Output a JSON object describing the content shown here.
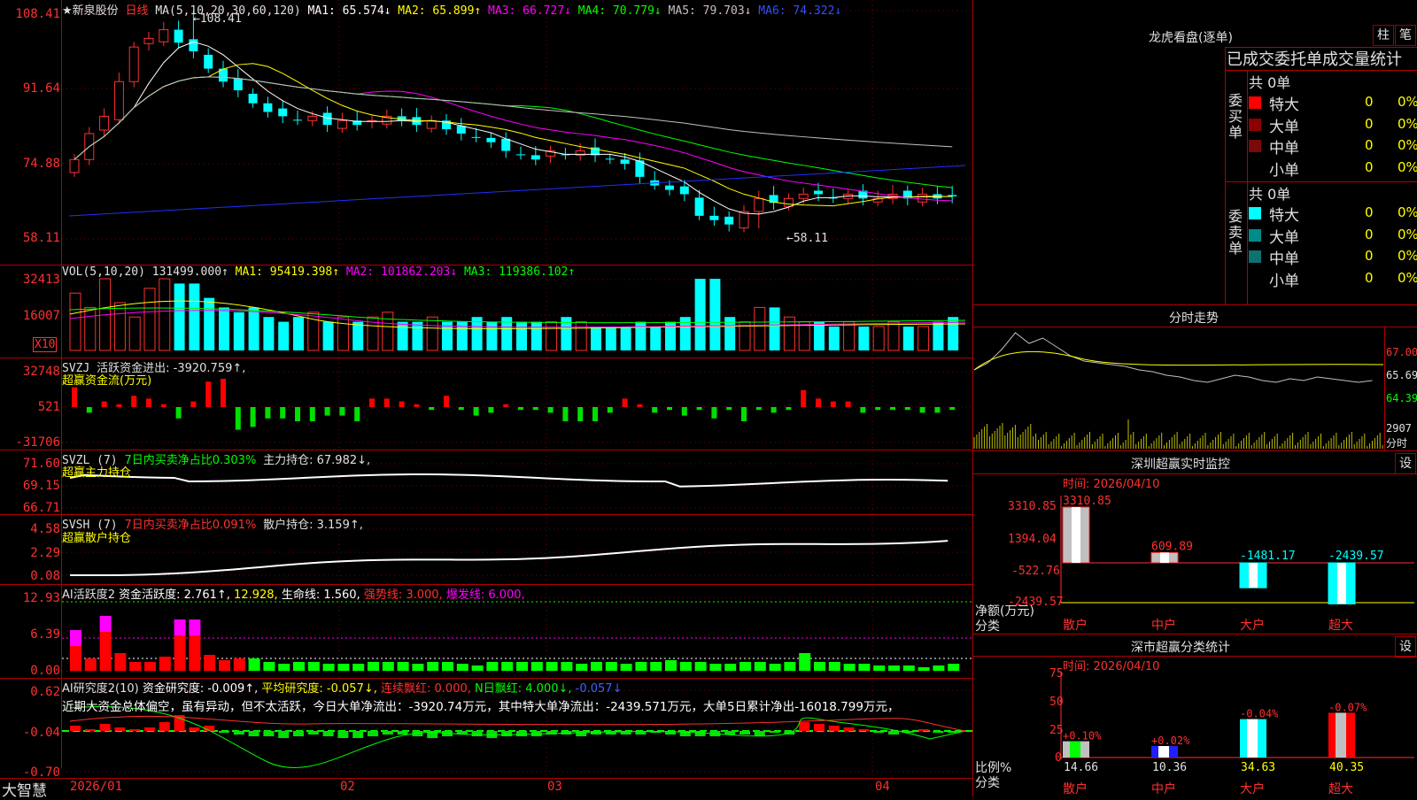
{
  "main_chart": {
    "stock_name": "新泉股份",
    "period": "日线",
    "ma_label": "MA(5,10,20,30,60,120)",
    "ma1": "MA1: 65.574↓",
    "ma2": "MA2: 65.899↑",
    "ma3": "MA3: 66.727↓",
    "ma4": "MA4: 70.779↓",
    "ma5": "MA5: 79.703↓",
    "ma6": "MA6: 74.322↓",
    "y_ticks": [
      "108.41",
      "91.64",
      "74.88",
      "58.11"
    ],
    "high_mark": "108.41",
    "low_mark": "58.11",
    "colors": {
      "up": "#ff3030",
      "down": "#00ffff",
      "ma1": "#ffffff",
      "ma2": "#ffff00",
      "ma3": "#ff00ff",
      "ma4": "#00ff00",
      "ma5": "#c0c0c0",
      "ma6": "#0000ff"
    }
  },
  "vol_panel": {
    "title": "VOL(5,10,20)",
    "value": "131499.000↑",
    "ma1": "MA1: 95419.398↑",
    "ma2": "MA2: 101862.203↓",
    "ma3": "MA3: 119386.102↑",
    "y_ticks": [
      "32413",
      "16007"
    ],
    "unit": "X10"
  },
  "svzj_panel": {
    "title": "SVZJ",
    "label": "活跃资金进出: -3920.759↑,",
    "sub": "超赢资金流(万元)",
    "y_ticks": [
      "32748",
      "521",
      "-31706"
    ]
  },
  "svzl_panel": {
    "title": "SVZL (7)",
    "net": "7日内买卖净占比0.303%",
    "hold": "主力持仓: 67.982↓,",
    "sub": "超赢主力持仓",
    "y_ticks": [
      "71.60",
      "69.15",
      "66.71"
    ]
  },
  "svsh_panel": {
    "title": "SVSH (7)",
    "net": "7日内买卖净占比0.091%",
    "hold": "散户持仓: 3.159↑,",
    "sub": "超赢散户持仓",
    "y_ticks": [
      "4.58",
      "2.29",
      "0.08"
    ]
  },
  "ai_active_panel": {
    "title": "AI活跃度2",
    "v1": "资金活跃度: 2.761↑,",
    "v2": "12.928,",
    "v3": "生命线: 1.560,",
    "v4": "强势线: 3.000,",
    "v5": "爆发线: 6.000,",
    "y_ticks": [
      "12.93",
      "6.39",
      "0.00"
    ]
  },
  "ai_research_panel": {
    "title": "AI研究度2(10)",
    "v1": "资金研究度: -0.009↑,",
    "v2": "平均研究度: -0.057↓,",
    "v3": "连续飘红: 0.000,",
    "v4": "N日飘红: 4.000↓,",
    "v5": "-0.057↓",
    "summary": "近期大资金总体偏空，虽有异动，但不太活跃，今日大单净流出：-3920.74万元，其中特大单净流出：-2439.571万元，大单5日累计净出-16018.799万元，",
    "y_ticks": [
      "0.62",
      "-0.04",
      "-0.70"
    ]
  },
  "date_axis": {
    "year_start": "2026/01",
    "months": [
      "02",
      "03",
      "04"
    ]
  },
  "brand": "大智慧",
  "right": {
    "dragon_title": "龙虎看盘(逐单)",
    "btn_zhu": "柱",
    "btn_bi": "笔",
    "tabs": [
      "已成交委托单成交量统计"
    ],
    "buy_label": "委买单",
    "sell_label": "委卖单",
    "buy_total": "共 0单",
    "sell_total": "共 0单",
    "buy_rows": [
      {
        "name": "特大",
        "count": "0",
        "pct": "0%",
        "color": "#ff0000"
      },
      {
        "name": "大单",
        "count": "0",
        "pct": "0%",
        "color": "#8b0000"
      },
      {
        "name": "中单",
        "count": "0",
        "pct": "0%",
        "color": "#7a0a0a"
      },
      {
        "name": "小单",
        "count": "0",
        "pct": "0%",
        "color": ""
      }
    ],
    "sell_rows": [
      {
        "name": "特大",
        "count": "0",
        "pct": "0%",
        "color": "#00ffff"
      },
      {
        "name": "大单",
        "count": "0",
        "pct": "0%",
        "color": "#008b8b"
      },
      {
        "name": "中单",
        "count": "0",
        "pct": "0%",
        "color": "#107070"
      },
      {
        "name": "小单",
        "count": "0",
        "pct": "0%",
        "color": ""
      }
    ],
    "fenshi_title": "分时走势",
    "fenshi_ticks": [
      "67.00",
      "65.69",
      "64.39",
      "2907",
      "分时"
    ],
    "monitor_title": "深圳超赢实时监控",
    "monitor_btn": "设",
    "monitor_time": "时间: 2026/04/10",
    "monitor_ticks": [
      "3310.85",
      "1394.04",
      "-522.76",
      "-2439.57"
    ],
    "monitor_ylabel": "净额(万元)",
    "monitor_xlabel": "分类",
    "monitor_values": [
      3310.85,
      609.89,
      -1481.17,
      -2439.57
    ],
    "monitor_labels": [
      "3310.85",
      "609.89",
      "-1481.17",
      "-2439.57"
    ],
    "categories": [
      "散户",
      "中户",
      "大户",
      "超大"
    ],
    "stats_title": "深市超赢分类统计",
    "stats_btn": "设",
    "stats_time": "时间: 2026/04/10",
    "stats_ticks": [
      "75",
      "50",
      "25",
      "0"
    ],
    "stats_ylabel": "比例%",
    "stats_xlabel": "分类",
    "stats_values": [
      14.66,
      10.36,
      34.63,
      40.35
    ],
    "stats_value_labels": [
      "14.66",
      "10.36",
      "34.63",
      "40.35"
    ],
    "stats_change_labels": [
      "+0.10%",
      "+0.02%",
      "-0.04%",
      "-0.07%"
    ]
  }
}
